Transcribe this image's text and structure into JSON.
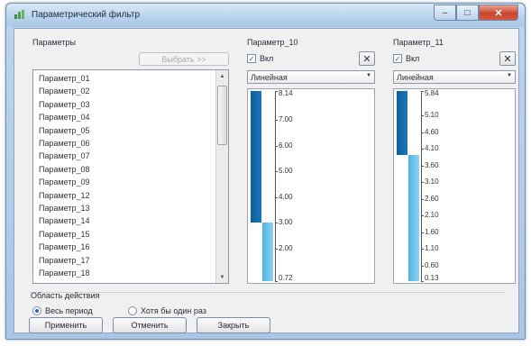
{
  "window": {
    "title": "Параметрический фильтр"
  },
  "titlebar_buttons": {
    "min": "–",
    "max": "□",
    "close": "✕"
  },
  "params": {
    "header": "Параметры",
    "select_button": "Выбрать >>",
    "items": [
      "Параметр_01",
      "Параметр_02",
      "Параметр_03",
      "Параметр_04",
      "Параметр_05",
      "Параметр_06",
      "Параметр_07",
      "Параметр_08",
      "Параметр_09",
      "Параметр_12",
      "Параметр_13",
      "Параметр_14",
      "Параметр_15",
      "Параметр_16",
      "Параметр_17",
      "Параметр_18"
    ]
  },
  "filters": [
    {
      "title": "Параметр_10",
      "enabled_label": "Вкл",
      "enabled": true,
      "scale": "Линейная",
      "tick_labels": [
        "8.14",
        "7.00",
        "6.00",
        "5.00",
        "4.00",
        "3.00",
        "2.00",
        "0.72"
      ],
      "chart_data": {
        "type": "bar",
        "ylim": [
          0.72,
          8.14
        ],
        "series": [
          {
            "range": [
              3.0,
              8.14
            ],
            "color": "#0f5f9a"
          },
          {
            "range": [
              0.72,
              3.0
            ],
            "color": "#4fb3e3"
          }
        ]
      }
    },
    {
      "title": "Параметр_11",
      "enabled_label": "Вкл",
      "enabled": true,
      "scale": "Линейная",
      "tick_labels": [
        "5.84",
        "5.10",
        "4.60",
        "4.10",
        "3.60",
        "3.10",
        "2.60",
        "2.10",
        "1.60",
        "1.10",
        "0.60",
        "0.13"
      ],
      "chart_data": {
        "type": "bar",
        "ylim": [
          0.13,
          5.84
        ],
        "series": [
          {
            "range": [
              3.93,
              5.84
            ],
            "color": "#0f5f9a"
          },
          {
            "range": [
              0.13,
              3.93
            ],
            "color": "#4fb3e3"
          }
        ]
      }
    }
  ],
  "scope": {
    "label": "Область действия",
    "options": [
      {
        "label": "Весь период",
        "checked": true
      },
      {
        "label": "Хотя бы один раз",
        "checked": false
      }
    ]
  },
  "buttons": {
    "apply": "Применить",
    "cancel": "Отменить",
    "close": "Закрыть"
  },
  "colors": {
    "bar_dark": "#0f5f9a",
    "bar_light": "#4fb3e3",
    "close_button": "#c8452c"
  }
}
